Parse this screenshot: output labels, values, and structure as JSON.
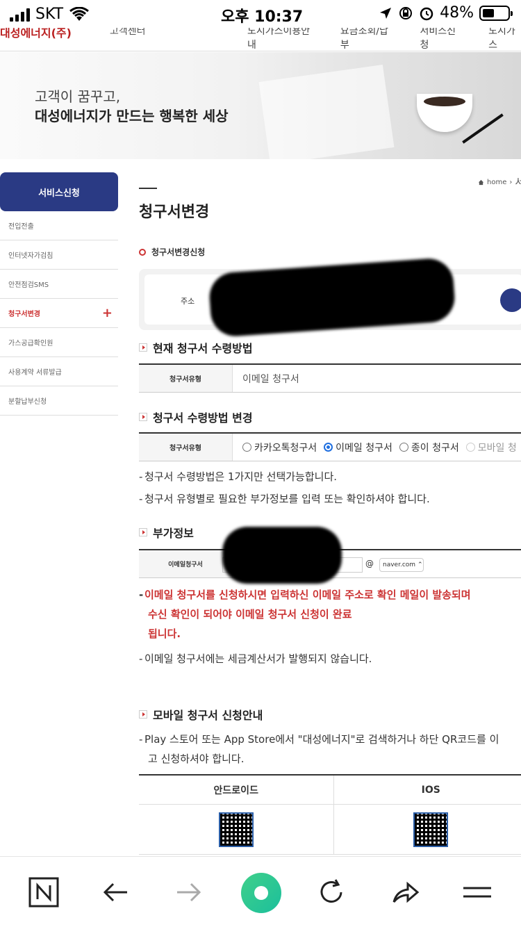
{
  "status": {
    "carrier": "SKT",
    "time": "오후 10:37",
    "battery": "48%",
    "battery_level": 0.48
  },
  "site": {
    "logo": "대성에너지(주)",
    "logo_sub": "고객센터",
    "nav": [
      "도시가스이용안내",
      "요금조회/납부",
      "서비스신청",
      "도시가스"
    ]
  },
  "banner": {
    "line1": "고객이 꿈꾸고,",
    "line2": "대성에너지가 만드는 행복한 세상"
  },
  "sidebar": {
    "title": "서비스신청",
    "items": [
      {
        "label": "전입전출"
      },
      {
        "label": "인터넷자가검침"
      },
      {
        "label": "안전점검SMS"
      },
      {
        "label": "청구서변경"
      },
      {
        "label": "가스공급확인원"
      },
      {
        "label": "사용계약 서류발급"
      },
      {
        "label": "분할납부신청"
      }
    ],
    "active_plus": "+"
  },
  "breadcrumb": {
    "home": "home",
    "next": "서"
  },
  "page": {
    "title": "청구서변경",
    "sub_title": "청구서변경신청",
    "address_label": "주소"
  },
  "current": {
    "heading": "현재 청구서 수령방법",
    "type_label": "청구서유형",
    "type_value": "이메일 청구서"
  },
  "change": {
    "heading": "청구서 수령방법 변경",
    "type_label": "청구서유형",
    "options": [
      {
        "label": "카카오톡청구서",
        "checked": false
      },
      {
        "label": "이메일 청구서",
        "checked": true
      },
      {
        "label": "종이 청구서",
        "checked": false
      },
      {
        "label": "모바일 청",
        "checked": false
      }
    ],
    "notes": [
      "청구서 수령방법은 1가지만 선택가능합니다.",
      "청구서 유형별로 필요한 부가정보를 입력 또는 확인하셔야 합니다."
    ]
  },
  "extra": {
    "heading": "부가정보",
    "email_label": "이메일청구서",
    "at": "@",
    "domain": "naver.com",
    "red_note_1": "이메일 청구서를 신청하시면 입력하신 이메일 주소로 확인 메일이 발송되며",
    "red_note_2": "수신 확인이 되어야 이메일 청구서 신청이 완료",
    "red_note_3": "됩니다.",
    "note": "이메일 청구서에는 세금계산서가 발행되지 않습니다."
  },
  "mobile": {
    "heading": "모바일 청구서 신청안내",
    "note_1": "Play 스토어 또는 App Store에서 \"대성에너지\"로 검색하거나 하단 QR코드를 이",
    "note_2": "고 신청하셔야 합니다.",
    "col_android": "안드로이드",
    "col_ios": "IOS"
  },
  "colors": {
    "brand": "#2a3a84",
    "accent": "#cc3333",
    "radio": "#1f6fe0"
  }
}
